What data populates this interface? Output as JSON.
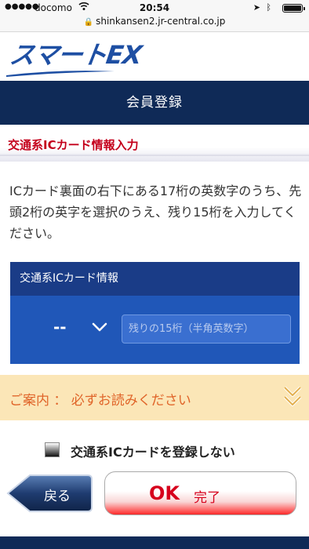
{
  "status_bar": {
    "carrier": "docomo",
    "time": "20:54",
    "battery_level": 1.0
  },
  "url_bar": {
    "url": "shinkansen2.jr-central.co.jp"
  },
  "logo": {
    "text": "スマートEX"
  },
  "header": {
    "title": "会員登録"
  },
  "section": {
    "title": "交通系ICカード情報入力",
    "instructions": "ICカード裏面の右下にある17桁の英数字のうち、先頭2桁の英字を選択のうえ、残り15桁を入力してください。"
  },
  "ic_panel": {
    "title": "交通系ICカード情報",
    "prefix_value": "--",
    "input_placeholder": "残りの15桁（半角英数字）",
    "input_value": ""
  },
  "notice": {
    "label": "ご案内 ： 必ずお読みください"
  },
  "checkbox": {
    "label": "交通系ICカードを登録しない",
    "checked": false
  },
  "buttons": {
    "back_label": "戻る",
    "ok_label": "OK",
    "done_label": "完了"
  },
  "colors": {
    "navy": "#0f2a57",
    "panel_blue": "#2057b8",
    "accent_red": "#c4001b",
    "notice_bg": "#fbe6b7",
    "notice_text": "#e0652a"
  }
}
